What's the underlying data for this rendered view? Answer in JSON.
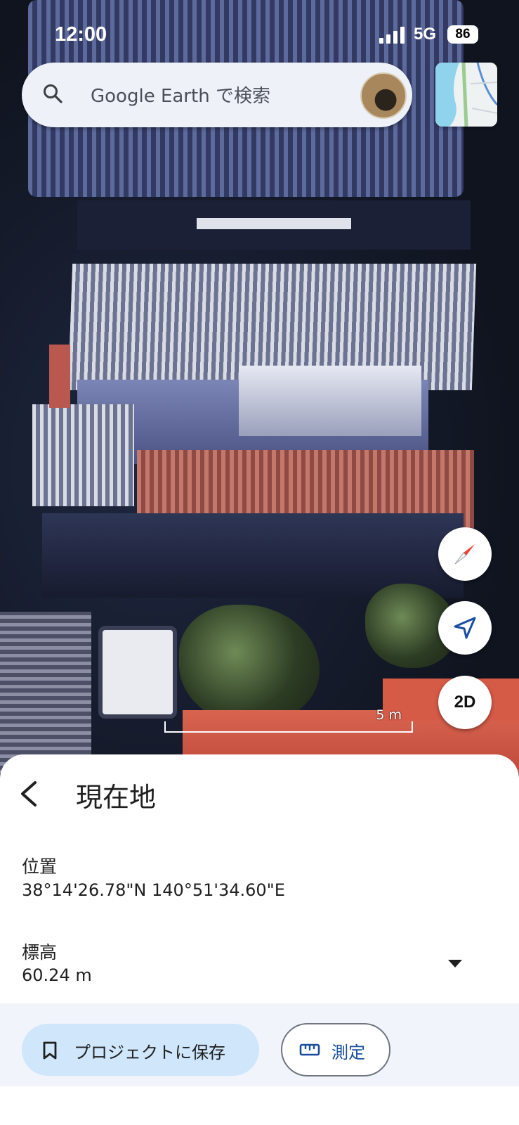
{
  "status_bar": {
    "time": "12:00",
    "network": "5G",
    "battery": "86"
  },
  "search": {
    "placeholder": "Google Earth で検索"
  },
  "map": {
    "scale_label": "5 m",
    "view_toggle_label": "2D"
  },
  "sheet": {
    "title": "現在地",
    "location_label": "位置",
    "location_value": "38°14'26.78\"N 140°51'34.60\"E",
    "elevation_label": "標高",
    "elevation_value": "60.24 m"
  },
  "actions": {
    "save_label": "プロジェクトに保存",
    "measure_label": "測定"
  },
  "colors": {
    "accent_blue": "#1a4fa0",
    "save_button_bg": "#cfe6fb",
    "compass_red": "#e94335"
  }
}
